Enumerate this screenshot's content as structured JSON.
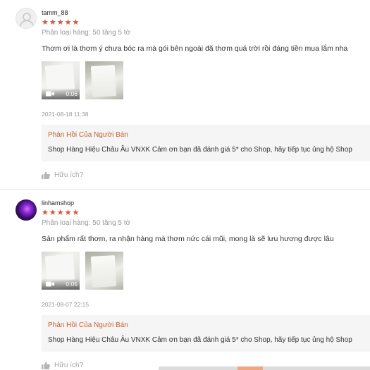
{
  "reviews": [
    {
      "username": "tamm_88",
      "rating_stars": 5,
      "stars_text": "★★★★★",
      "variation": "Phân loại hàng: 50 tăng 5 tờ",
      "comment": "Thơm ơi là thơm ý chưa bóc ra mà gói bên ngoài đã thơm quá trời rồi đáng tiền mua lắm nha",
      "video_duration": "0:06",
      "timestamp": "2021-08-18 11:38",
      "seller_reply": {
        "title": "Phản Hồi Của Người Bán",
        "text": "Shop Hàng Hiệu Châu Âu VNXK Cảm ơn bạn đã đánh giá 5* cho Shop, hãy tiếp tục ủng hộ Shop"
      },
      "helpful_label": "Hữu ích?"
    },
    {
      "username": "linhamshop",
      "rating_stars": 5,
      "stars_text": "★★★★★",
      "variation": "Phân loại hàng: 50 tăng 5 tờ",
      "comment": "Sản phẩm rất thơm, ra nhận hàng mà thơm nức cái mũi, mong là sẽ lưu hương được lâu",
      "video_duration": "0:05",
      "timestamp": "2021-08-07 22:15",
      "seller_reply": {
        "title": "Phản Hồi Của Người Bán",
        "text": "Shop Hàng Hiệu Châu Âu VNXK Cảm ơn bạn đã đánh giá 5* cho Shop, hãy tiếp tục ủng hộ Shop"
      },
      "helpful_label": "Hữu ích?"
    }
  ],
  "colors": {
    "star": "#ee4d2d",
    "reply_title": "#c26436",
    "muted_text": "#9a9a9a",
    "reply_background": "#f5f5f5"
  }
}
